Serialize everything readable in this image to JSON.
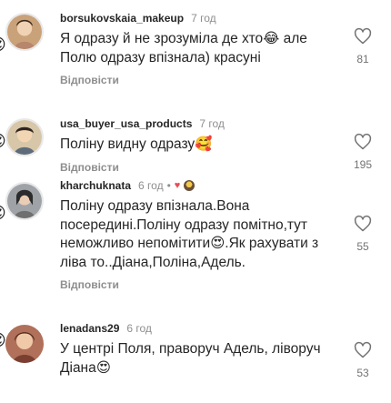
{
  "comments": [
    {
      "username": "borsukovskaia_makeup",
      "time": "7 год",
      "text": "Я одразу й не зрозуміла де хто😂 але Полю одразу впізнала) красуні",
      "reply_label": "Відповісти",
      "likes": "81",
      "avatar_icon": "profile-photo-icon"
    },
    {
      "username": "usa_buyer_usa_products",
      "time": "7 год",
      "text": "Поліну видну одразу🥰",
      "reply_label": "Відповісти",
      "likes": "195",
      "avatar_icon": "profile-photo-icon"
    },
    {
      "username": "kharchuknata",
      "time": "6 год",
      "separator": "•",
      "author_like_icon": "heart-filled-icon",
      "text": "Поліну одразу  впізнала.Вона посередині.Поліну одразу помітно,тут неможливо непомітити😍.Як рахувати з ліва то..Діана,Поліна,Адель.",
      "reply_label": "Відповісти",
      "likes": "55",
      "avatar_icon": "profile-photo-icon"
    },
    {
      "username": "lenadans29",
      "time": "6 год",
      "text": "У центрі Поля, праворуч Адель, ліворуч Діана😍",
      "reply_label": "",
      "likes": "53",
      "avatar_icon": "profile-photo-icon"
    }
  ],
  "left_emojis": [
    "😍",
    "😍",
    "😍",
    "😍"
  ],
  "colors": {
    "text": "#262626",
    "secondary": "#8e8e8e",
    "like_red": "#ed4956"
  }
}
